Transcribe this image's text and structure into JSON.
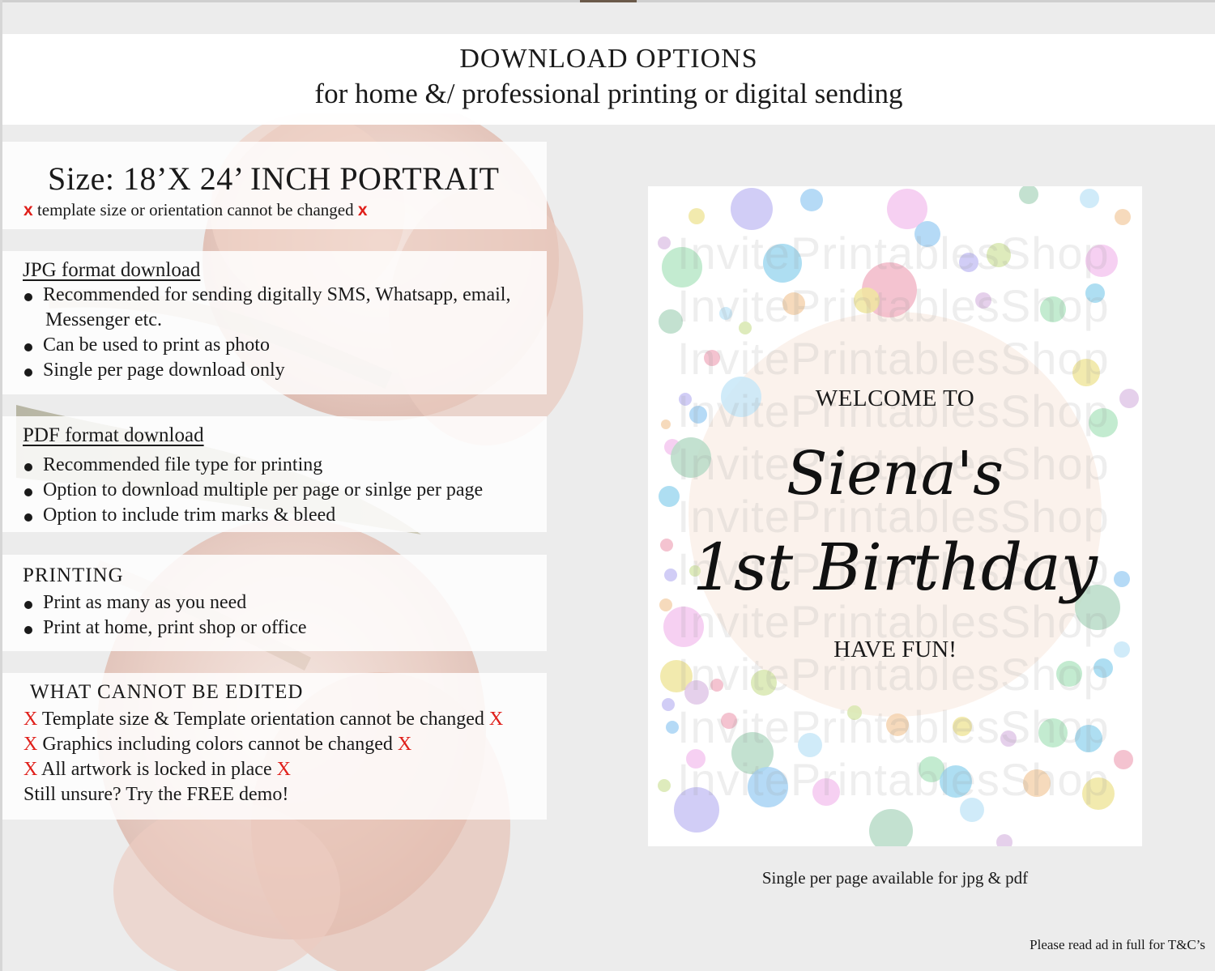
{
  "header": {
    "title": "DOWNLOAD OPTIONS",
    "subtitle": "for home &/ professional printing or digital sending"
  },
  "size_panel": {
    "title": "Size: 18’X 24’ INCH PORTRAIT",
    "note_marker": "x",
    "note": "template size or orientation cannot be changed"
  },
  "jpg_panel": {
    "title": "JPG format download",
    "bullets": [
      "Recommended for sending digitally SMS, Whatsapp, email,",
      "Can be used to print as photo",
      "Single per page download only"
    ],
    "bullet_continuation": "Messenger etc."
  },
  "pdf_panel": {
    "title": "PDF format download",
    "bullets": [
      "Recommended file type for printing",
      "Option to download multiple per page or sinlge per page",
      "Option to include trim marks & bleed"
    ]
  },
  "printing_panel": {
    "title": "PRINTING",
    "bullets": [
      "Print as many as you need",
      "Print at home, print shop or office"
    ]
  },
  "edit_panel": {
    "title": "WHAT CANNOT BE EDITED",
    "marker": "X",
    "lines": [
      "Template size & Template orientation cannot be changed",
      "Graphics including colors cannot be changed",
      "All artwork is locked in place"
    ],
    "closing": "Still unsure? Try the FREE demo!"
  },
  "sign": {
    "welcome": "WELCOME TO",
    "name": "Siena's",
    "occasion": "1st Birthday",
    "closing": "HAVE FUN!",
    "watermark": "InvitePrintablesShop",
    "dot_colors": [
      "#c9c4f5",
      "#a8d4f5",
      "#f5c8f0",
      "#b8dcc8",
      "#c8e8f8",
      "#f5d4b0",
      "#f0e6a0",
      "#e0c8e8",
      "#b8e8c8",
      "#a0d8f0",
      "#f2b8c8",
      "#d8e8b0"
    ]
  },
  "caption": "Single per page available for jpg & pdf",
  "footnote": "Please read ad in full for T&C’s"
}
